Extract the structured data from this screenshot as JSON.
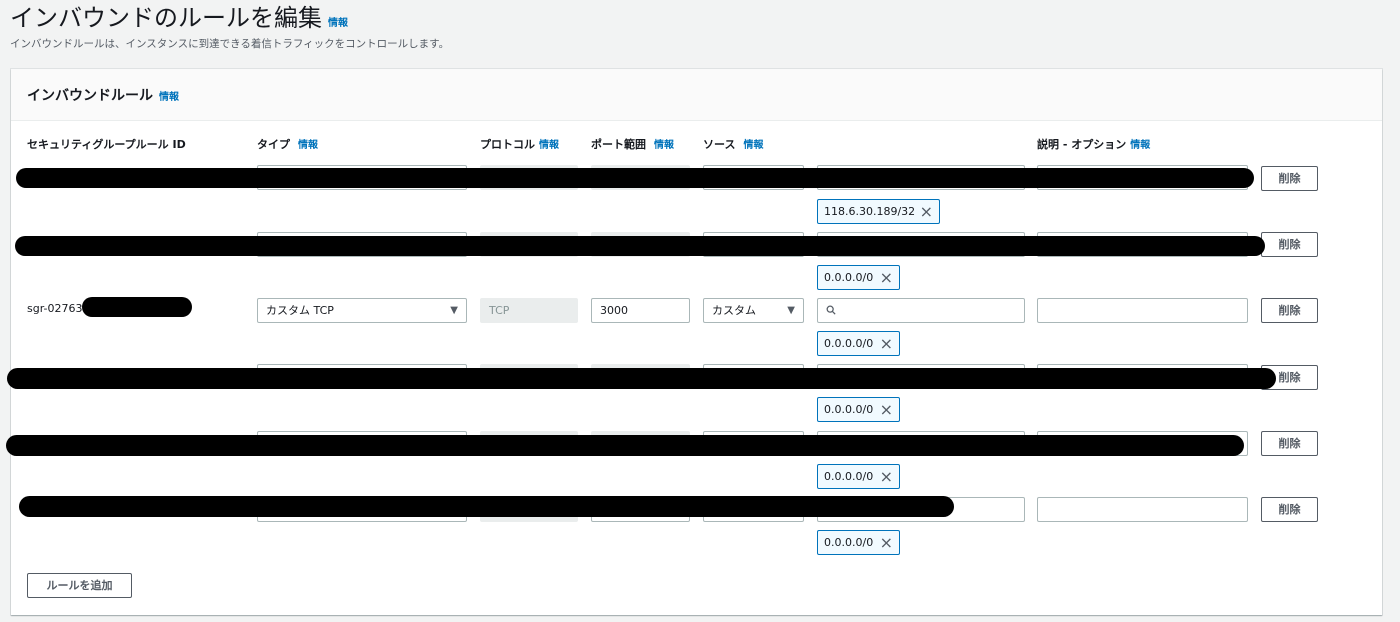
{
  "header": {
    "title": "インバウンドのルールを編集",
    "info": "情報",
    "description": "インバウンドルールは、インスタンスに到達できる着信トラフィックをコントロールします。"
  },
  "panel": {
    "title": "インバウンドルール",
    "info": "情報",
    "columns": {
      "rule_id": "セキュリティグループルール ID",
      "type": "タイプ",
      "protocol": "プロトコル",
      "port_range": "ポート範囲",
      "source": "ソース",
      "description": "説明 - オプション",
      "info": "情報"
    },
    "rows": [
      {
        "token": "118.6.30.189/32",
        "delete": "削除"
      },
      {
        "token": "0.0.0.0/0",
        "delete": "削除"
      },
      {
        "rule_id": "sgr-02763",
        "type": "カスタム TCP",
        "protocol": "TCP",
        "port": "3000",
        "source": "カスタム",
        "token": "0.0.0.0/0",
        "delete": "削除"
      },
      {
        "token": "0.0.0.0/0",
        "delete": "削除"
      },
      {
        "token": "0.0.0.0/0",
        "delete": "削除"
      },
      {
        "token": "0.0.0.0/0",
        "delete": "削除"
      }
    ],
    "add_rule": "ルールを追加"
  },
  "icons": {
    "caret": "caret-down-icon",
    "search": "search-icon",
    "remove": "close-icon"
  }
}
